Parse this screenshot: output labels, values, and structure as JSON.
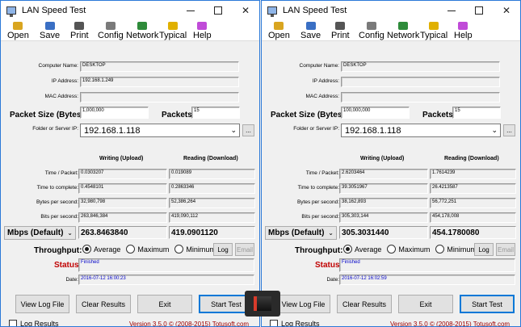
{
  "windows": [
    {
      "id": "left",
      "title": "LAN Speed Test",
      "toolbar": [
        "Open",
        "Save",
        "Print",
        "Config",
        "Network",
        "Typical",
        "Help"
      ],
      "labels": {
        "computer_name": "Computer Name:",
        "ip_address": "IP Address:",
        "mac_address": "MAC Address:",
        "packet_size": "Packet Size (Bytes):",
        "packets": "Packets:",
        "folder_server": "Folder or Server IP:",
        "writing": "Writing (Upload)",
        "reading": "Reading (Download)",
        "time_packet": "Time / Packet:",
        "time_complete": "Time to complete:",
        "bytes_per_second": "Bytes per second:",
        "bits_per_second": "Bits per second:",
        "throughput": "Throughput:",
        "status": "Status:",
        "date": "Date:"
      },
      "computer_name": "DESKTOP",
      "ip_address": "192.168.1.249",
      "mac_address": "",
      "packet_size": "1,000,000",
      "packets": "15",
      "server_ip": "192.168.1.118",
      "browse_button": "...",
      "upload": {
        "time_packet": "0.0303207",
        "time_complete": "0.4548101",
        "bytes_per_second": "32,980,798",
        "bits_per_second": "263,846,384"
      },
      "download": {
        "time_packet": "0.019089",
        "time_complete": "0.2863346",
        "bytes_per_second": "52,386,264",
        "bits_per_second": "419,090,112"
      },
      "unit_select": "Mbps (Default)",
      "mbps_upload": "263.8463840",
      "mbps_download": "419.0901120",
      "throughput_options": [
        "Average",
        "Maximum",
        "Minimum"
      ],
      "throughput_selected": "Average",
      "log_button": "Log",
      "email_button": "Email",
      "status": "Finished",
      "date": "2016-07-12 16:00:23",
      "buttons": {
        "view_log": "View Log File",
        "clear_results": "Clear Results",
        "exit": "Exit",
        "start_test": "Start Test"
      },
      "log_results": "Log Results",
      "version": "Version 3.5.0",
      "copyright": "© (2008-2015) Totusoft.com"
    },
    {
      "id": "right",
      "title": "LAN Speed Test",
      "toolbar": [
        "Open",
        "Save",
        "Print",
        "Config",
        "Network",
        "Typical",
        "Help"
      ],
      "labels": {
        "computer_name": "Computer Name:",
        "ip_address": "IP Address:",
        "mac_address": "MAC Address:",
        "packet_size": "Packet Size (Bytes):",
        "packets": "Packets:",
        "folder_server": "Folder or Server IP:",
        "writing": "Writing (Upload)",
        "reading": "Reading (Download)",
        "time_packet": "Time / Packet:",
        "time_complete": "Time to complete:",
        "bytes_per_second": "Bytes per second:",
        "bits_per_second": "Bits per second:",
        "throughput": "Throughput:",
        "status": "Status:",
        "date": "Date:"
      },
      "computer_name": "DESKTOP",
      "ip_address": "",
      "mac_address": "",
      "packet_size": "100,000,000",
      "packets": "15",
      "server_ip": "192.168.1.118",
      "browse_button": "...",
      "upload": {
        "time_packet": "2.6203464",
        "time_complete": "39.3051967",
        "bytes_per_second": "38,162,893",
        "bits_per_second": "305,303,144"
      },
      "download": {
        "time_packet": "1.7614239",
        "time_complete": "26.4213587",
        "bytes_per_second": "56,772,251",
        "bits_per_second": "454,178,008"
      },
      "unit_select": "Mbps (Default)",
      "mbps_upload": "305.3031440",
      "mbps_download": "454.1780080",
      "throughput_options": [
        "Average",
        "Maximum",
        "Minimum"
      ],
      "throughput_selected": "Average",
      "log_button": "Log",
      "email_button": "Email",
      "status": "Finished",
      "date": "2016-07-12 16:02:59",
      "buttons": {
        "view_log": "View Log File",
        "clear_results": "Clear Results",
        "exit": "Exit",
        "start_test": "Start Test"
      },
      "log_results": "Log Results",
      "version": "Version 3.5.0",
      "copyright": "© (2008-2015) Totusoft.com"
    }
  ],
  "toolbar_icons": [
    "folder-open-icon",
    "save-icon",
    "printer-icon",
    "config-icon",
    "network-icon",
    "typical-icon",
    "help-icon"
  ],
  "toolbar_icon_colors": [
    "#d9a520",
    "#3a6fc4",
    "#555555",
    "#7a7a7a",
    "#2e8b3a",
    "#e0b000",
    "#c04bd8"
  ],
  "accent_color": "#0078d7",
  "status_color": "#c00000",
  "value_color": "#0000c8"
}
